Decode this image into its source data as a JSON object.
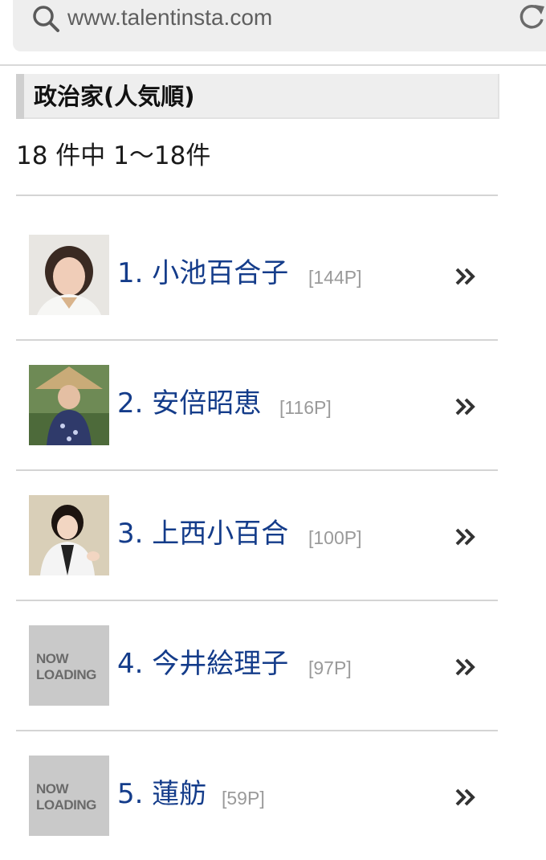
{
  "browser": {
    "url": "www.talentinsta.com",
    "search_icon": "search-icon",
    "reload_icon": "reload-icon"
  },
  "category": {
    "title": "政治家(人気順)"
  },
  "results": {
    "count_text": "18 件中 1〜18件"
  },
  "items": [
    {
      "name": "1. 小池百合子",
      "pages": "[144P]",
      "thumb": "photo"
    },
    {
      "name": "2. 安倍昭恵",
      "pages": "[116P]",
      "thumb": "photo"
    },
    {
      "name": "3. 上西小百合",
      "pages": "[100P]",
      "thumb": "photo"
    },
    {
      "name": "4. 今井絵理子",
      "pages": "[97P]",
      "thumb": "now-loading"
    },
    {
      "name": "5. 蓮舫",
      "pages": "[59P]",
      "thumb": "now-loading"
    }
  ],
  "placeholder": {
    "line1": "NOW",
    "line2": "LOADING"
  },
  "colors": {
    "link": "#143c8a",
    "muted": "#9a9a9a",
    "header_bg": "#eeeeee"
  }
}
